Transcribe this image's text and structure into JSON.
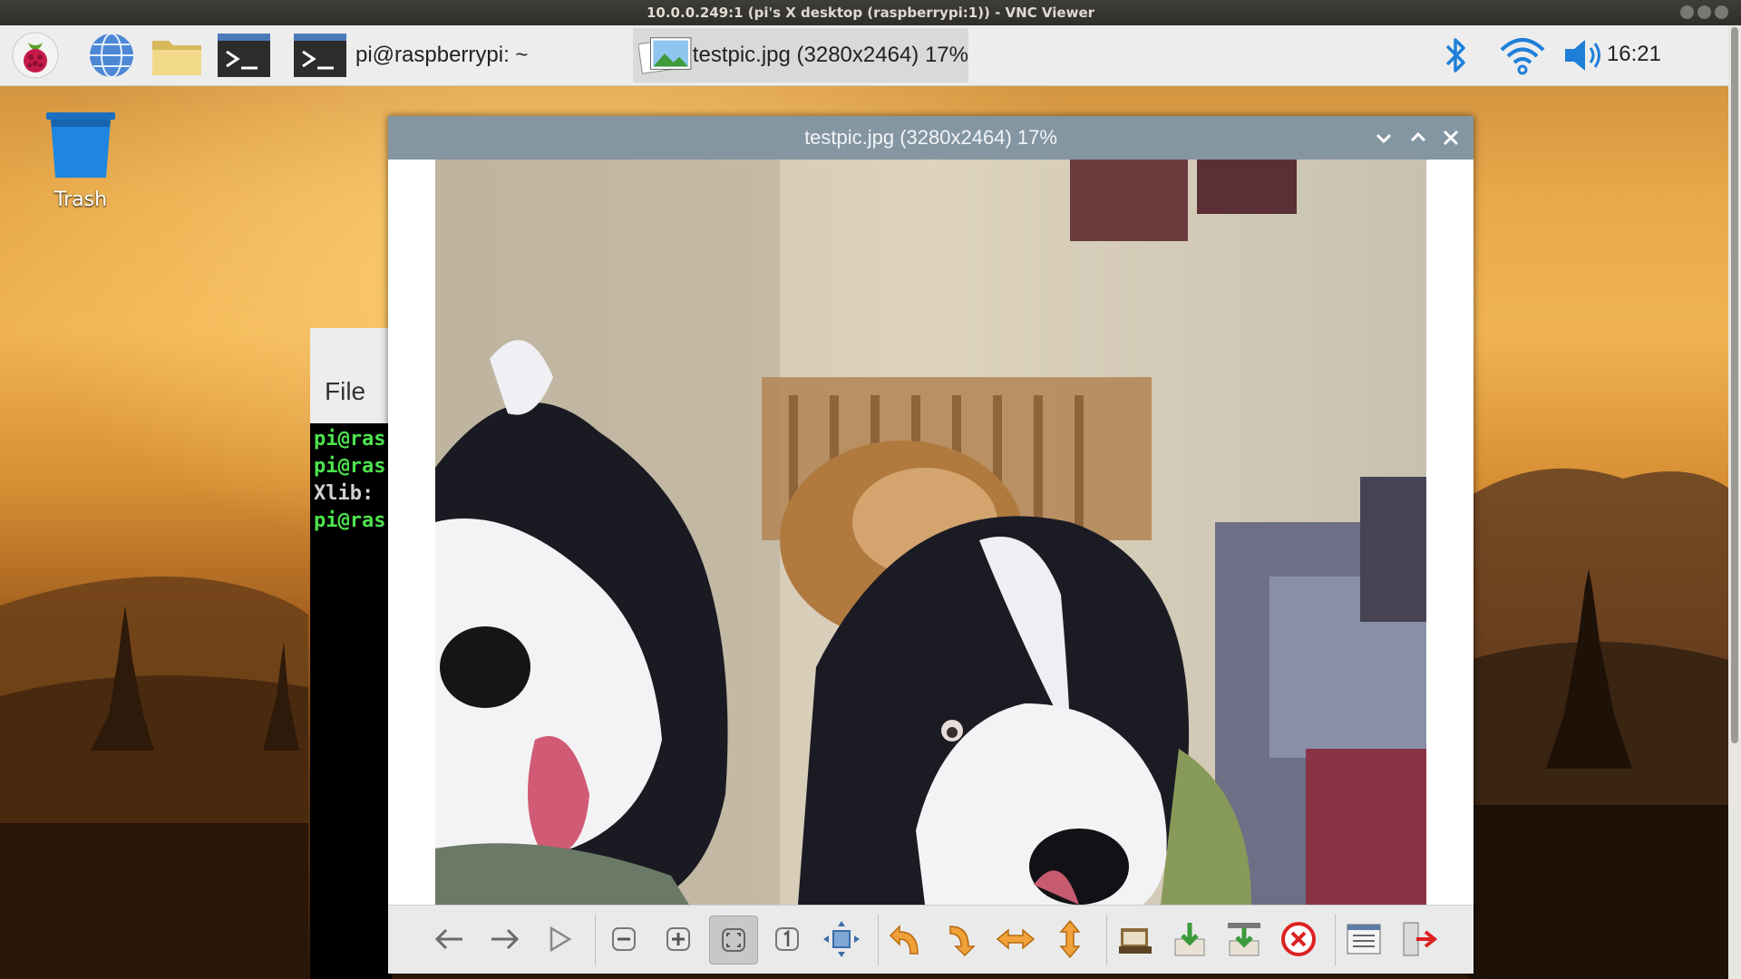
{
  "vnc": {
    "title": "10.0.0.249:1 (pi's X desktop (raspberrypi:1)) - VNC Viewer"
  },
  "panel": {
    "launchers": [
      "raspberry-menu-icon",
      "web-browser-icon",
      "file-manager-icon",
      "terminal-icon"
    ],
    "tasks": [
      {
        "label": "pi@raspberrypi: ~",
        "icon": "terminal-icon"
      },
      {
        "label": "testpic.jpg (3280x2464) 17%",
        "icon": "image-viewer-icon",
        "active": true
      }
    ],
    "tray": [
      "bluetooth-icon",
      "wifi-icon",
      "volume-icon"
    ],
    "clock": "16:21"
  },
  "desktop": {
    "trash_label": "Trash"
  },
  "terminal": {
    "menu_file": "File",
    "lines": [
      {
        "text": "pi@ras",
        "color": "#4ee44e"
      },
      {
        "text": "pi@ras",
        "color": "#4ee44e"
      },
      {
        "text": "Xlib:",
        "color": "#d0d0d0"
      },
      {
        "text": "pi@ras",
        "color": "#4ee44e"
      }
    ]
  },
  "viewer": {
    "title": "testpic.jpg (3280x2464) 17%",
    "toolbar": [
      "previous-icon",
      "next-icon",
      "slideshow-icon",
      "zoom-out-icon",
      "zoom-in-icon",
      "fit-to-window-icon",
      "original-size-icon",
      "fullscreen-icon",
      "rotate-left-icon",
      "rotate-right-icon",
      "flip-horizontal-icon",
      "flip-vertical-icon",
      "open-file-icon",
      "save-icon",
      "save-as-icon",
      "delete-icon",
      "preferences-icon",
      "quit-icon"
    ]
  },
  "colors": {
    "panel_bg": "#ededed",
    "viewer_titlebar": "#8596a3",
    "terminal_green": "#4ee44e"
  }
}
